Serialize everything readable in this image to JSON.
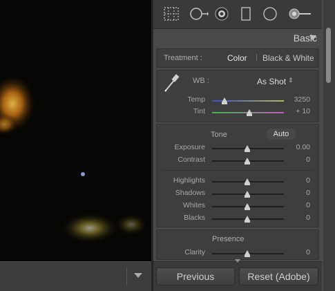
{
  "tools": {
    "icons": [
      "crop-overlay-icon",
      "spot-removal-icon",
      "red-eye-icon",
      "graduated-filter-icon",
      "radial-filter-icon",
      "adjustment-brush-icon"
    ]
  },
  "basic": {
    "title": "Basic",
    "treatment_label": "Treatment :",
    "treatment_color": "Color",
    "treatment_bw": "Black & White",
    "wb_label": "WB :",
    "wb_value": "As Shot",
    "temp_label": "Temp",
    "temp_value": "3250",
    "tint_label": "Tint",
    "tint_value": "+ 10",
    "tone_label": "Tone",
    "auto_label": "Auto",
    "exposure_label": "Exposure",
    "exposure_value": "0.00",
    "contrast_label": "Contrast",
    "contrast_value": "0",
    "highlights_label": "Highlights",
    "highlights_value": "0",
    "shadows_label": "Shadows",
    "shadows_value": "0",
    "whites_label": "Whites",
    "whites_value": "0",
    "blacks_label": "Blacks",
    "blacks_value": "0",
    "presence_label": "Presence",
    "clarity_label": "Clarity",
    "clarity_value": "0"
  },
  "buttons": {
    "previous": "Previous",
    "reset": "Reset (Adobe)"
  }
}
